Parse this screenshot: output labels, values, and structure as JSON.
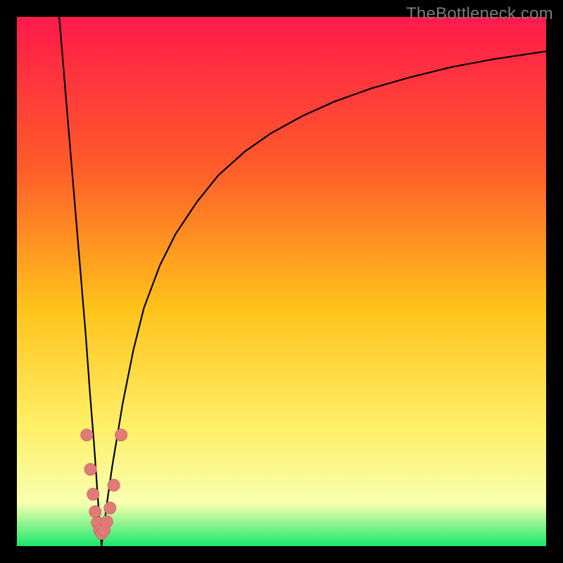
{
  "watermark": "TheBottleneck.com",
  "colors": {
    "frame": "#000000",
    "curve": "#000000",
    "marker_fill": "#e07b78",
    "marker_stroke": "#d46a67",
    "gradient_top": "#ff1a4b",
    "gradient_upper": "#ff5a2a",
    "gradient_mid": "#ffc31a",
    "gradient_lower": "#fff06a",
    "gradient_pale": "#f7ffb0",
    "gradient_bottom": "#17e86b"
  },
  "chart_data": {
    "type": "line",
    "title": "",
    "xlabel": "",
    "ylabel": "",
    "x_range": [
      0,
      100
    ],
    "y_range": [
      0,
      100
    ],
    "notch_x": 16,
    "series": [
      {
        "name": "left-branch",
        "x": [
          8,
          9,
          10,
          11,
          12,
          13,
          13.8,
          14.6,
          15.3,
          16
        ],
        "y": [
          100,
          88,
          76,
          64,
          52,
          40,
          29,
          19,
          9,
          0
        ]
      },
      {
        "name": "right-branch",
        "x": [
          16,
          17,
          18,
          20,
          22,
          24,
          27,
          30,
          34,
          38,
          43,
          48,
          54,
          60,
          67,
          74,
          82,
          90,
          100
        ],
        "y": [
          0,
          8,
          15,
          27,
          37,
          45,
          53,
          59,
          65,
          70,
          74.5,
          78,
          81.3,
          84,
          86.5,
          88.5,
          90.5,
          92,
          93.5
        ]
      }
    ],
    "markers": {
      "name": "notch-points",
      "points": [
        {
          "x": 13.2,
          "y": 21
        },
        {
          "x": 13.9,
          "y": 14.5
        },
        {
          "x": 14.4,
          "y": 9.8
        },
        {
          "x": 14.8,
          "y": 6.5
        },
        {
          "x": 15.2,
          "y": 4.4
        },
        {
          "x": 15.6,
          "y": 3.0
        },
        {
          "x": 16.0,
          "y": 2.4
        },
        {
          "x": 16.5,
          "y": 3.0
        },
        {
          "x": 17.0,
          "y": 4.6
        },
        {
          "x": 17.6,
          "y": 7.2
        },
        {
          "x": 18.3,
          "y": 11.5
        },
        {
          "x": 19.7,
          "y": 21
        }
      ]
    }
  }
}
